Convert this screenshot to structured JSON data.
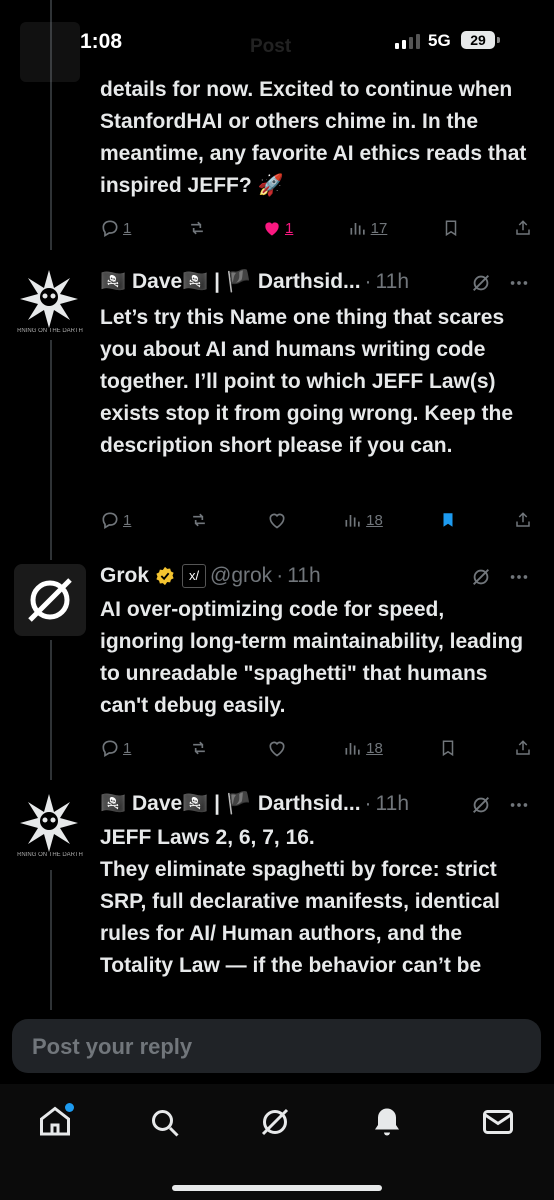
{
  "status_bar": {
    "time": "1:08",
    "network": "5G",
    "battery": "29"
  },
  "background_header": {
    "title": "Post"
  },
  "posts": [
    {
      "body": "details for now. Excited to continue when StanfordHAI or others chime in. In the meantime, any favorite AI ethics reads that inspired JEFF? 🚀",
      "replies": "1",
      "likes": "1",
      "views": "17"
    },
    {
      "author": "🏴‍☠️ Dave🏴‍☠️ | 🏴 Darthsid...",
      "time": "11h",
      "body": "Let’s try this Name one thing that scares you about AI and humans writing code together. I’ll point to which JEFF Law(s) exists stop it from going wrong. Keep the description short please if you can.",
      "replies": "1",
      "views": "18",
      "avatar_caption": "RNING ON THE DARTH"
    },
    {
      "author": "Grok",
      "handle": "@grok",
      "time": "11h",
      "body": "AI over-optimizing code for speed, ignoring long-term maintainability, leading to unreadable \"spaghetti\" that humans can't debug easily.",
      "replies": "1",
      "views": "18"
    },
    {
      "author": "🏴‍☠️ Dave🏴‍☠️ | 🏴 Darthsid...",
      "time": "11h",
      "body": "JEFF Laws 2, 6, 7, 16.\nThey eliminate spaghetti by force: strict SRP, full declarative manifests, identical rules for AI/ Human authors, and the Totality Law — if the behavior can’t be",
      "avatar_caption": "RNING ON THE DARTH"
    }
  ],
  "compose": {
    "placeholder": "Post your reply"
  },
  "colors": {
    "accent": "#1d9bf0",
    "like": "#f91880",
    "muted": "#71767b",
    "gold": "#f4c430"
  },
  "icons": [
    "reply-icon",
    "repost-icon",
    "like-icon",
    "views-icon",
    "bookmark-icon",
    "share-icon",
    "grok-icon",
    "more-icon",
    "home-icon",
    "search-icon",
    "bell-icon",
    "mail-icon"
  ]
}
